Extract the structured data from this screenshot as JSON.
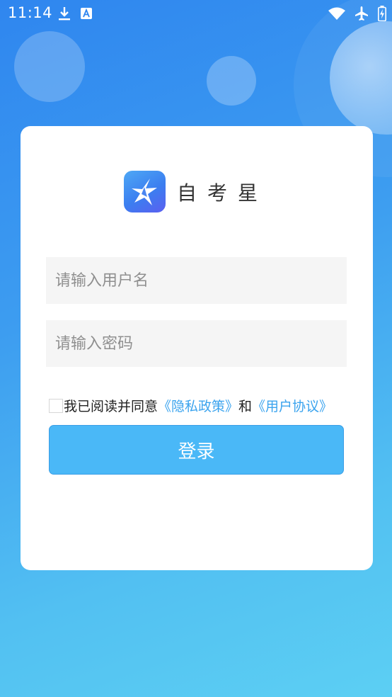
{
  "status_bar": {
    "time": "11:14",
    "icons_left": [
      "download-icon",
      "notification-a-icon"
    ],
    "icons_right": [
      "wifi-icon",
      "airplane-mode-icon",
      "battery-charging-icon"
    ]
  },
  "brand": {
    "app_name": "自考星",
    "logo_icon": "star-logo-icon"
  },
  "form": {
    "username_placeholder": "请输入用户名",
    "username_value": "",
    "password_placeholder": "请输入密码",
    "password_value": ""
  },
  "agreement": {
    "checked": false,
    "prefix": "我已阅读并同意",
    "privacy_link": "《隐私政策》",
    "conjunction": "和",
    "user_agreement_link": "《用户协议》"
  },
  "login_button_label": "登录",
  "colors": {
    "accent": "#4ab8f7",
    "link": "#3aa3ee",
    "background_top": "#2f86ef",
    "background_bottom": "#5ccff3"
  }
}
